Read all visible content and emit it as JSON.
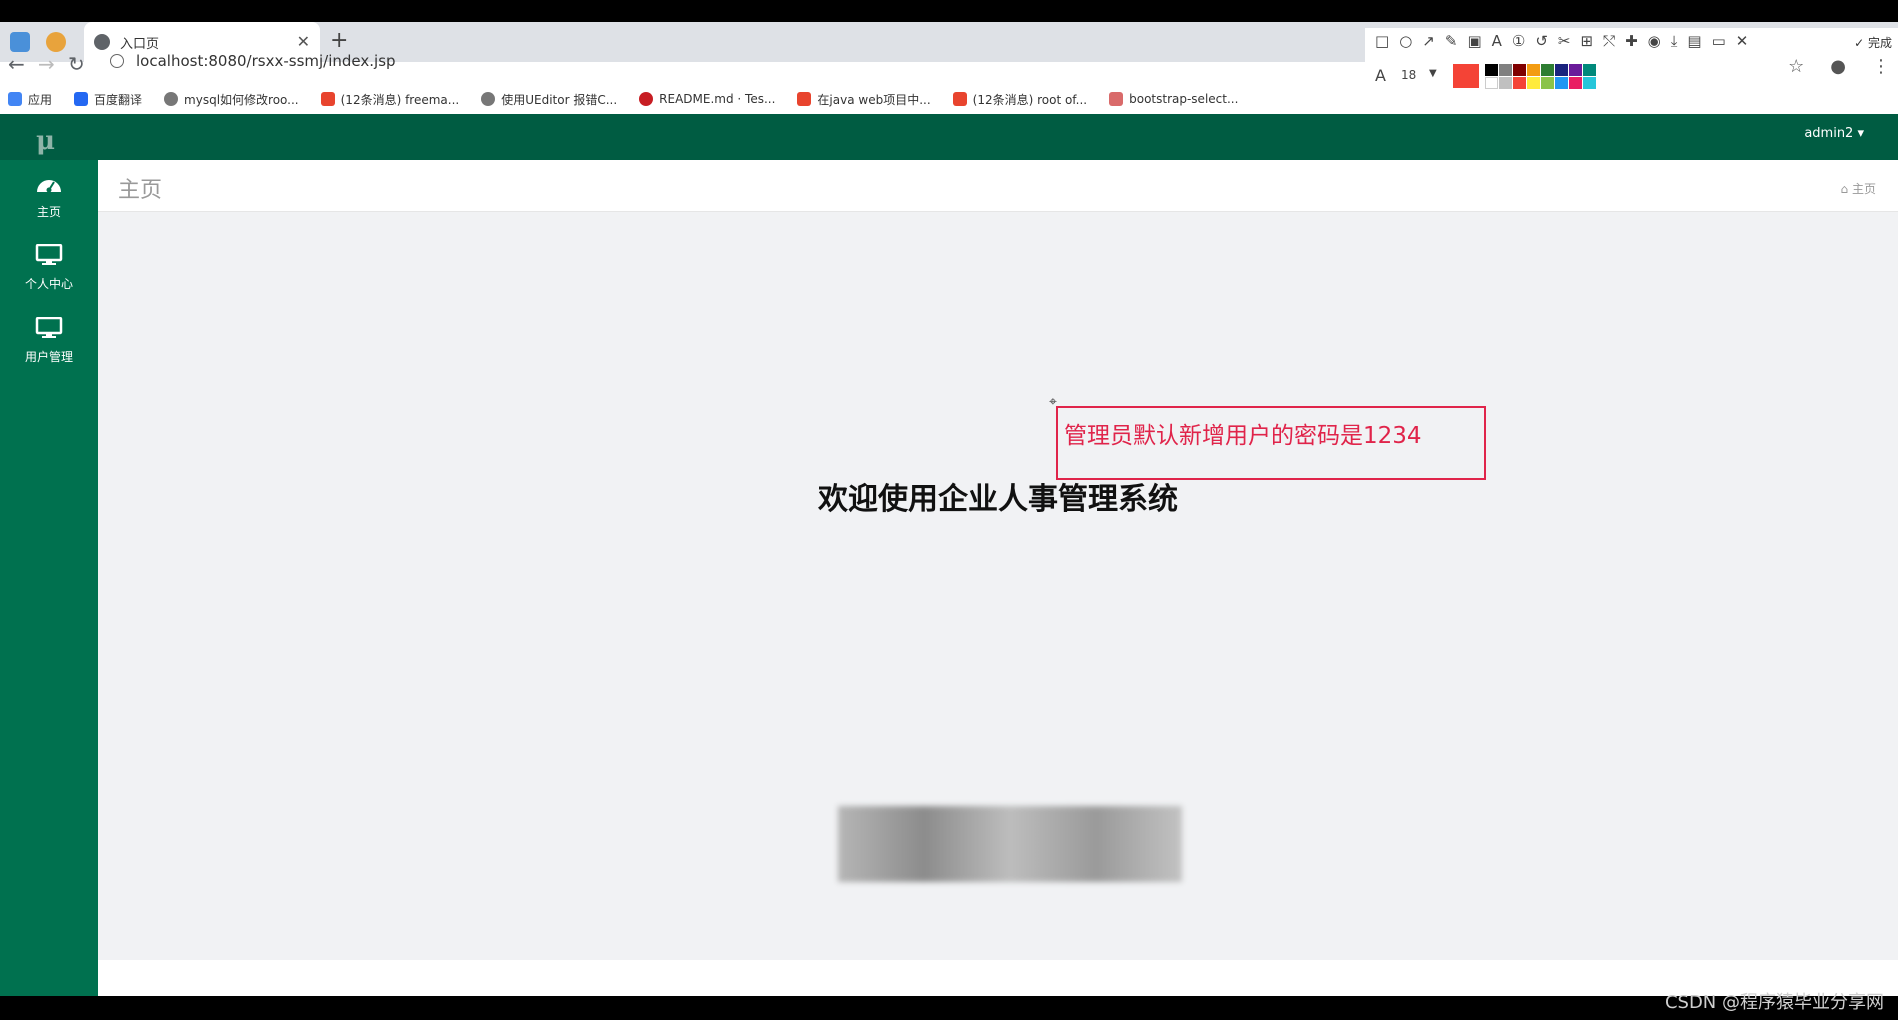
{
  "browser": {
    "tab_title": "入口页",
    "url": "localhost:8080/rsxx-ssmj/index.jsp",
    "bookmarks": [
      "应用",
      "百度翻译",
      "mysql如何修改roo...",
      "(12条消息) freema...",
      "使用UEditor 报错C...",
      "README.md · Tes...",
      "在java web项目中...",
      "(12条消息) root of...",
      "bootstrap-select..."
    ]
  },
  "screenshot_tool": {
    "done_label": "完成",
    "font_size": "18",
    "current_color": "#f44336"
  },
  "app": {
    "logo": "μ",
    "user_menu": "admin2 ▾",
    "sidebar": [
      {
        "label": "主页"
      },
      {
        "label": "个人中心"
      },
      {
        "label": "用户管理"
      }
    ],
    "page_title": "主页",
    "breadcrumb": "主页",
    "welcome": "欢迎使用企业人事管理系统",
    "annotation": "管理员默认新增用户的密码是1234"
  },
  "watermark": "CSDN @程序猿毕业分享网",
  "colors": {
    "topbar": "#005c42",
    "sidebar": "#00714f",
    "annotation": "#e0244a"
  }
}
